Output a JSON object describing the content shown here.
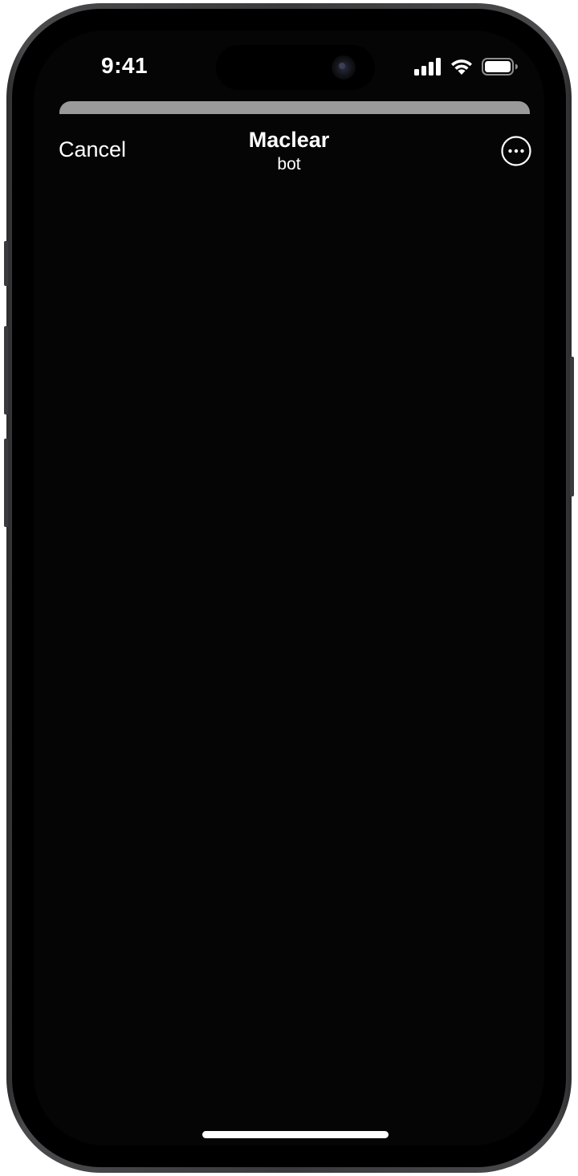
{
  "status_bar": {
    "time": "9:41",
    "icons": [
      "cellular-signal-icon",
      "wifi-icon",
      "battery-icon"
    ]
  },
  "nav": {
    "cancel_label": "Cancel",
    "title": "Maclear",
    "subtitle": "bot",
    "more_icon": "ellipsis-circle-icon"
  },
  "colors": {
    "background": "#050506",
    "text": "#ffffff",
    "sheet_handle_bar": "#9a9a9a"
  }
}
